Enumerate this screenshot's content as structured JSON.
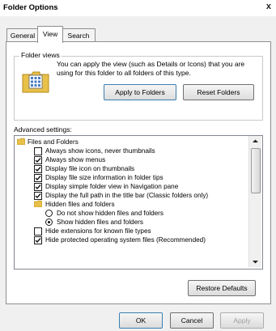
{
  "window": {
    "title": "Folder Options",
    "close_glyph": "x"
  },
  "tabs": [
    {
      "label": "General",
      "active": false
    },
    {
      "label": "View",
      "active": true
    },
    {
      "label": "Search",
      "active": false
    }
  ],
  "folder_views": {
    "legend": "Folder views",
    "description": "You can apply the view (such as Details or Icons) that you are using for this folder to all folders of this type.",
    "apply_button": "Apply to Folders",
    "reset_button": "Reset Folders",
    "icon": "folder-view-icon"
  },
  "advanced": {
    "label": "Advanced settings:",
    "items": [
      {
        "label": "Files and Folders",
        "type": "folder",
        "indent": 0
      },
      {
        "label": "Always show icons, never thumbnails",
        "type": "checkbox",
        "checked": false,
        "indent": 1
      },
      {
        "label": "Always show menus",
        "type": "checkbox",
        "checked": true,
        "indent": 1
      },
      {
        "label": "Display file icon on thumbnails",
        "type": "checkbox",
        "checked": true,
        "indent": 1
      },
      {
        "label": "Display file size information in folder tips",
        "type": "checkbox",
        "checked": true,
        "indent": 1
      },
      {
        "label": "Display simple folder view in Navigation pane",
        "type": "checkbox",
        "checked": true,
        "indent": 1
      },
      {
        "label": "Display the full path in the title bar (Classic folders only)",
        "type": "checkbox",
        "checked": true,
        "indent": 1
      },
      {
        "label": "Hidden files and folders",
        "type": "folder",
        "indent": 1
      },
      {
        "label": "Do not show hidden files and folders",
        "type": "radio",
        "checked": false,
        "indent": 2
      },
      {
        "label": "Show hidden files and folders",
        "type": "radio",
        "checked": true,
        "indent": 2
      },
      {
        "label": "Hide extensions for known file types",
        "type": "checkbox",
        "checked": false,
        "indent": 1
      },
      {
        "label": "Hide protected operating system files (Recommended)",
        "type": "checkbox",
        "checked": true,
        "indent": 1
      }
    ]
  },
  "restore_button": "Restore Defaults",
  "footer": {
    "ok": "OK",
    "cancel": "Cancel",
    "apply": "Apply"
  },
  "colors": {
    "disabled_text": "#a0a0a0",
    "folder_yellow": "#e8c04a",
    "default_button_border": "#3c7fb1"
  }
}
